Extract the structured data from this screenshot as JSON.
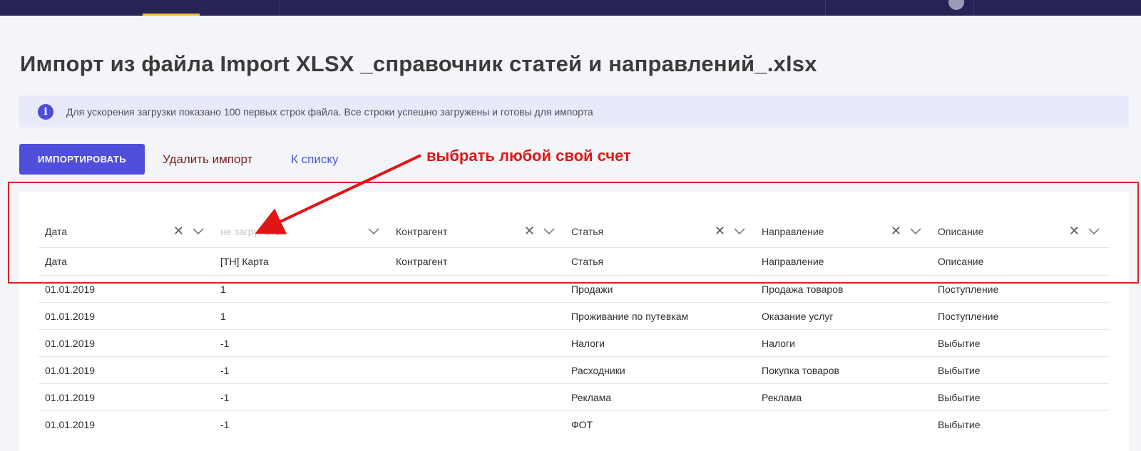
{
  "page": {
    "title": "Импорт из файла Import XLSX _справочник статей и направлений_.xlsx"
  },
  "banner": {
    "icon": "info-icon",
    "icon_glyph": "i",
    "text": "Для ускорения загрузки показано 100 первых строк файла. Все строки успешно загружены и готовы для импорта"
  },
  "actions": {
    "import_label": "ИМПОРТИРОВАТЬ",
    "delete_label": "Удалить импорт",
    "back_label": "К списку"
  },
  "annotation": {
    "text": "выбрать любой свой счет",
    "color": "#e01616"
  },
  "colors": {
    "topbar": "#262457",
    "accent": "#4f4fdc",
    "active_tab": "#f5c23a"
  },
  "table": {
    "header_selects": [
      {
        "value": "Дата",
        "placeholder": false,
        "clearable": true
      },
      {
        "value": "не загружать",
        "placeholder": true,
        "clearable": false
      },
      {
        "value": "Контрагент",
        "placeholder": false,
        "clearable": true
      },
      {
        "value": "Статья",
        "placeholder": false,
        "clearable": true
      },
      {
        "value": "Направление",
        "placeholder": false,
        "clearable": true
      },
      {
        "value": "Описание",
        "placeholder": false,
        "clearable": true
      }
    ],
    "file_headers": [
      "Дата",
      "[TH] Карта",
      "Контрагент",
      "Статья",
      "Направление",
      "Описание"
    ],
    "rows": [
      [
        "01.01.2019",
        "1",
        "",
        "Продажи",
        "Продажа товаров",
        "Поступление"
      ],
      [
        "01.01.2019",
        "1",
        "",
        "Проживание по путевкам",
        "Оказание услуг",
        "Поступление"
      ],
      [
        "01.01.2019",
        "-1",
        "",
        "Налоги",
        "Налоги",
        "Выбытие"
      ],
      [
        "01.01.2019",
        "-1",
        "",
        "Расходники",
        "Покупка товаров",
        "Выбытие"
      ],
      [
        "01.01.2019",
        "-1",
        "",
        "Реклама",
        "Реклама",
        "Выбытие"
      ],
      [
        "01.01.2019",
        "-1",
        "",
        "ФОТ",
        "",
        "Выбытие"
      ]
    ]
  }
}
